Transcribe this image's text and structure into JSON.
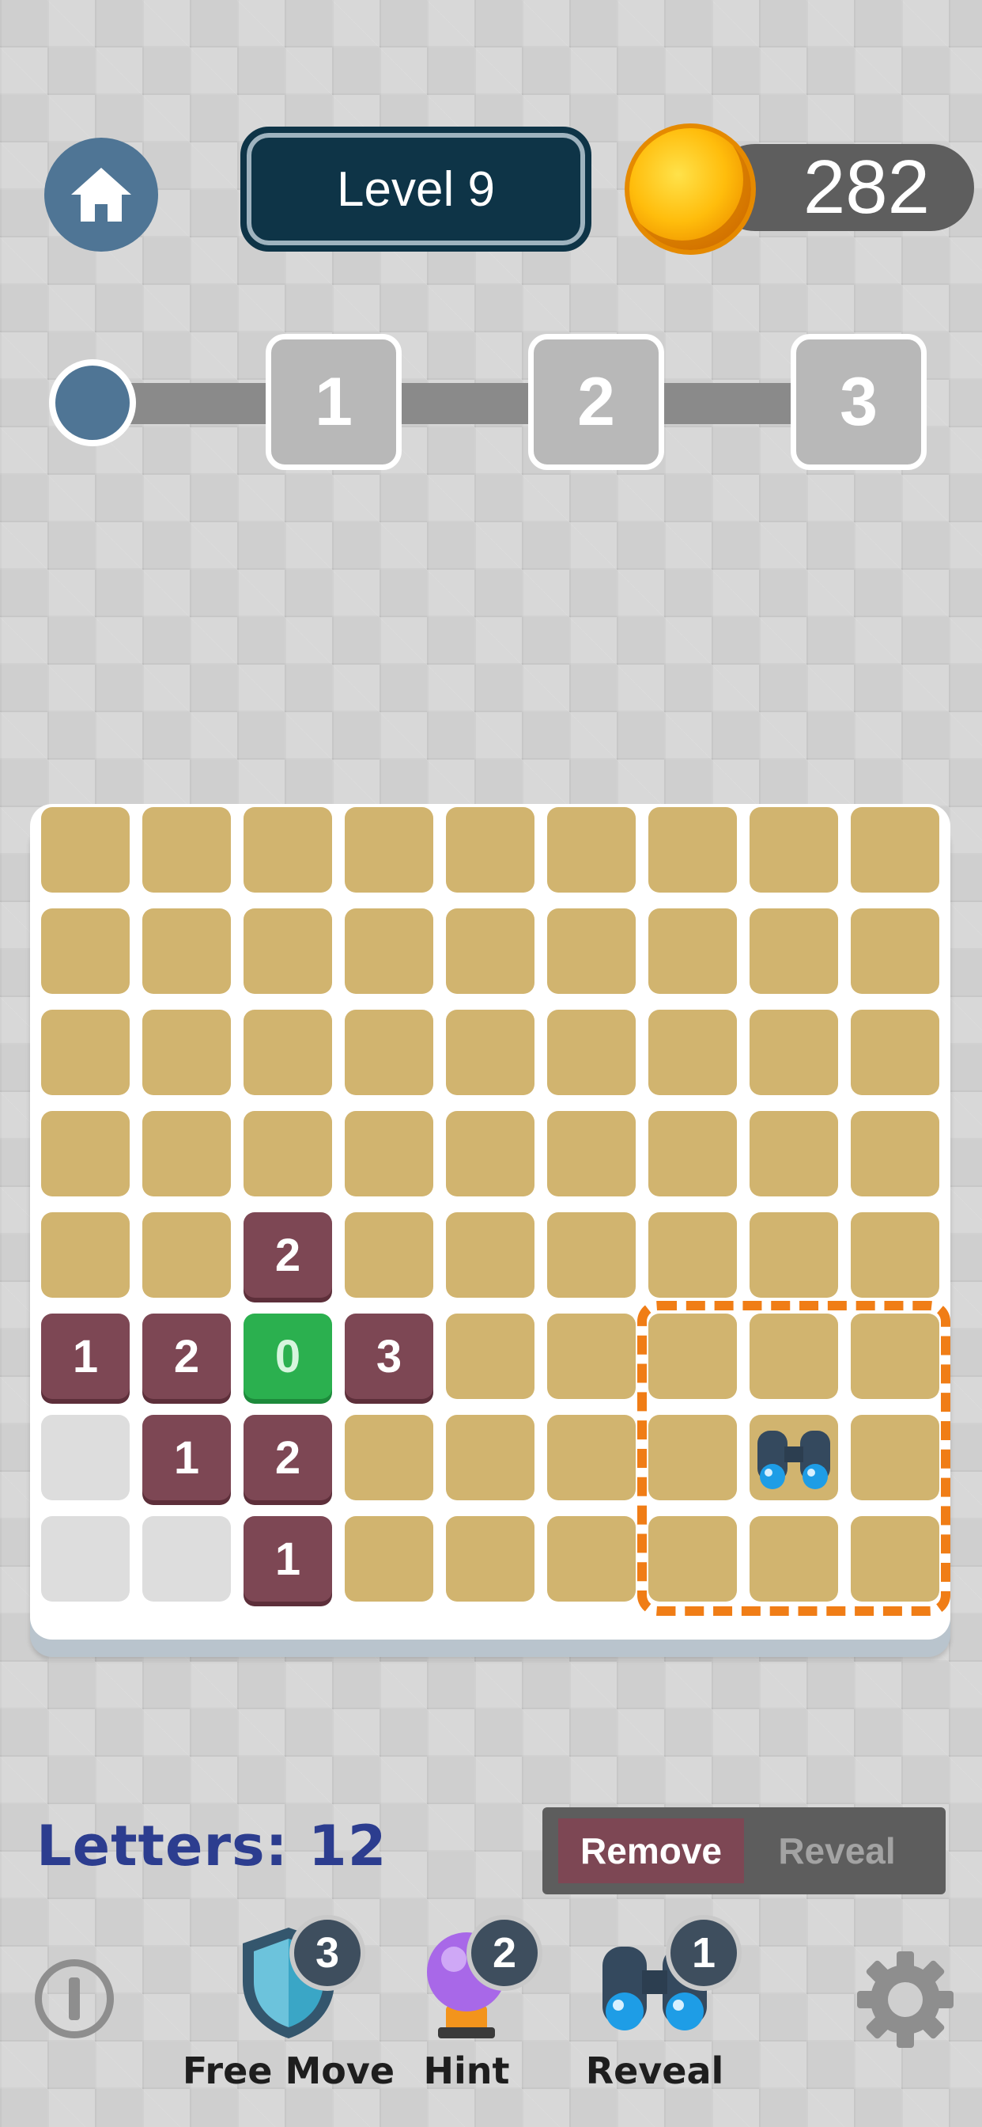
{
  "header": {
    "level_label": "Level 9",
    "coins": "282"
  },
  "progress": {
    "stages": [
      "1",
      "2",
      "3"
    ]
  },
  "board": {
    "rows": [
      [
        "h",
        "h",
        "h",
        "h",
        "h",
        "h",
        "h",
        "h",
        "h"
      ],
      [
        "h",
        "h",
        "h",
        "h",
        "h",
        "h",
        "h",
        "h",
        "h"
      ],
      [
        "h",
        "h",
        "h",
        "h",
        "h",
        "h",
        "h",
        "h",
        "h"
      ],
      [
        "h",
        "h",
        "h",
        "h",
        "h",
        "h",
        "h",
        "h",
        "h"
      ],
      [
        "h",
        "h",
        "2",
        "h",
        "h",
        "h",
        "h",
        "h",
        "h"
      ],
      [
        "1",
        "2",
        "0",
        "3",
        "h",
        "h",
        "h",
        "h",
        "h"
      ],
      [
        "e",
        "1",
        "2",
        "h",
        "h",
        "h",
        "h",
        "binoculars",
        "h"
      ],
      [
        "e",
        "e",
        "1",
        "h",
        "h",
        "h",
        "h",
        "h",
        "h"
      ]
    ]
  },
  "footer": {
    "letters_label": "Letters: 12",
    "mode_remove": "Remove",
    "mode_reveal": "Reveal",
    "tools": [
      {
        "label": "Free Move",
        "count": "3",
        "icon": "shield-icon"
      },
      {
        "label": "Hint",
        "count": "2",
        "icon": "crystal-ball-icon"
      },
      {
        "label": "Reveal",
        "count": "1",
        "icon": "binoculars-icon"
      }
    ]
  },
  "colors": {
    "hidden_tile": "#d1b46f",
    "number_tile": "#7d4754",
    "zero_tile": "#2bb04f",
    "empty_tile": "#dddddd",
    "accent_orange": "#f07d16",
    "navy": "#0e3447"
  }
}
